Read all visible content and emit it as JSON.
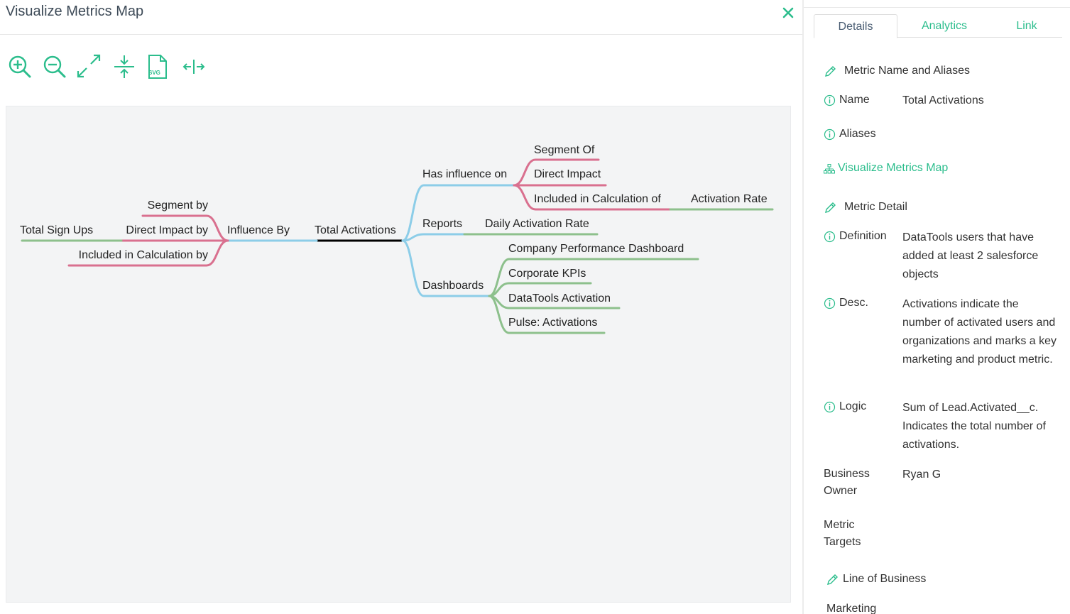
{
  "modal": {
    "title": "Visualize Metrics Map"
  },
  "map": {
    "root": "Total Activations",
    "nodes": {
      "influence_by": "Influence By",
      "segment_by": "Segment by",
      "direct_impact_by": "Direct Impact by",
      "included_calc_by": "Included in Calculation by",
      "total_sign_ups": "Total Sign Ups",
      "has_influence_on": "Has influence on",
      "segment_of": "Segment Of",
      "direct_impact": "Direct Impact",
      "included_calc_of": "Included in Calculation of",
      "activation_rate": "Activation Rate",
      "reports": "Reports",
      "daily_activation_rate": "Daily Activation Rate",
      "dashboards": "Dashboards",
      "company_perf_dashboard": "Company Performance Dashboard",
      "corporate_kpis": "Corporate KPIs",
      "datatools_activation": "DataTools Activation",
      "pulse_activations": "Pulse: Activations"
    },
    "colors": {
      "blue": "#8ccde8",
      "pink": "#d9708f",
      "green": "#8dc08c",
      "black": "#000000"
    }
  },
  "tabs": [
    {
      "label": "Details",
      "active": true
    },
    {
      "label": "Analytics",
      "active": false
    },
    {
      "label": "Link",
      "active": false
    }
  ],
  "details": {
    "section_name_aliases": "Metric Name and Aliases",
    "name_label": "Name",
    "name_value": "Total Activations",
    "aliases_label": "Aliases",
    "visualize_link": "Visualize Metrics Map",
    "section_metric_detail": "Metric Detail",
    "definition_label": "Definition",
    "definition_value": "DataTools users that have added at least 2 salesforce objects",
    "desc_label": "Desc.",
    "desc_value": "Activations indicate the number of activated users and organizations and marks a key marketing and product metric.",
    "logic_label": "Logic",
    "logic_value": "Sum of Lead.Activated__c. Indicates the total number of activations.",
    "business_owner_label": "Business Owner",
    "business_owner_value": "Ryan G",
    "metric_targets_label": "Metric Targets",
    "section_line_of_business": "Line of Business",
    "line_of_business_value": "Marketing"
  },
  "accent_color": "#2bbd8c"
}
